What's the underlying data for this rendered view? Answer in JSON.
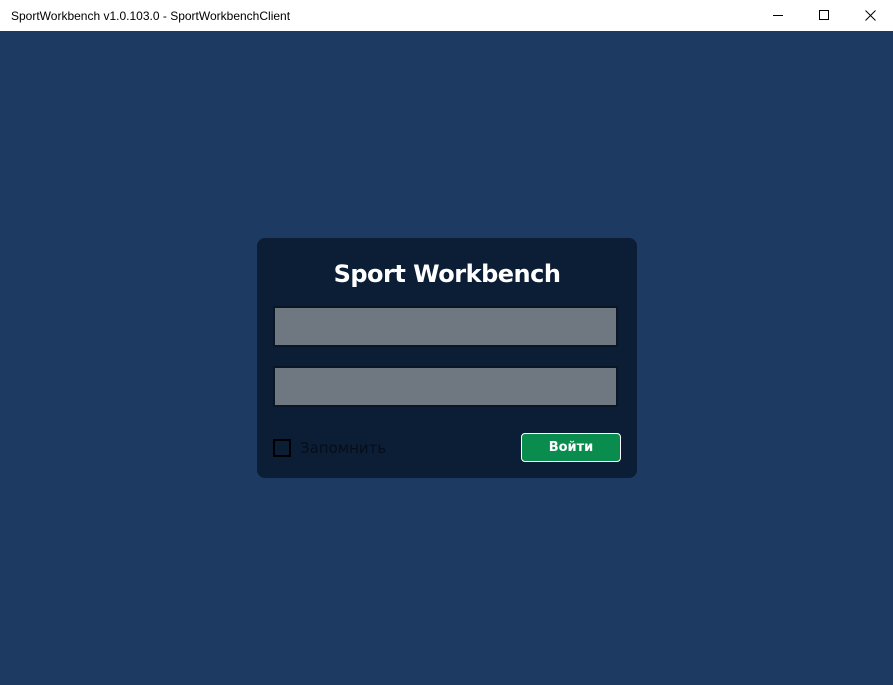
{
  "window": {
    "title": "SportWorkbench v1.0.103.0 - SportWorkbenchClient",
    "controls": {
      "minimize_icon": "minimize-icon",
      "maximize_icon": "maximize-icon",
      "close_icon": "close-icon"
    }
  },
  "login": {
    "app_title": "Sport Workbench",
    "username_value": "",
    "password_value": "",
    "remember_label": "Запомнить",
    "remember_checked": false,
    "submit_label": "Войти"
  },
  "colors": {
    "background": "#1c3a62",
    "panel": "#0c1d36",
    "field": "#6f7880",
    "button": "#0a8c4e",
    "title_text": "#ffffff"
  }
}
